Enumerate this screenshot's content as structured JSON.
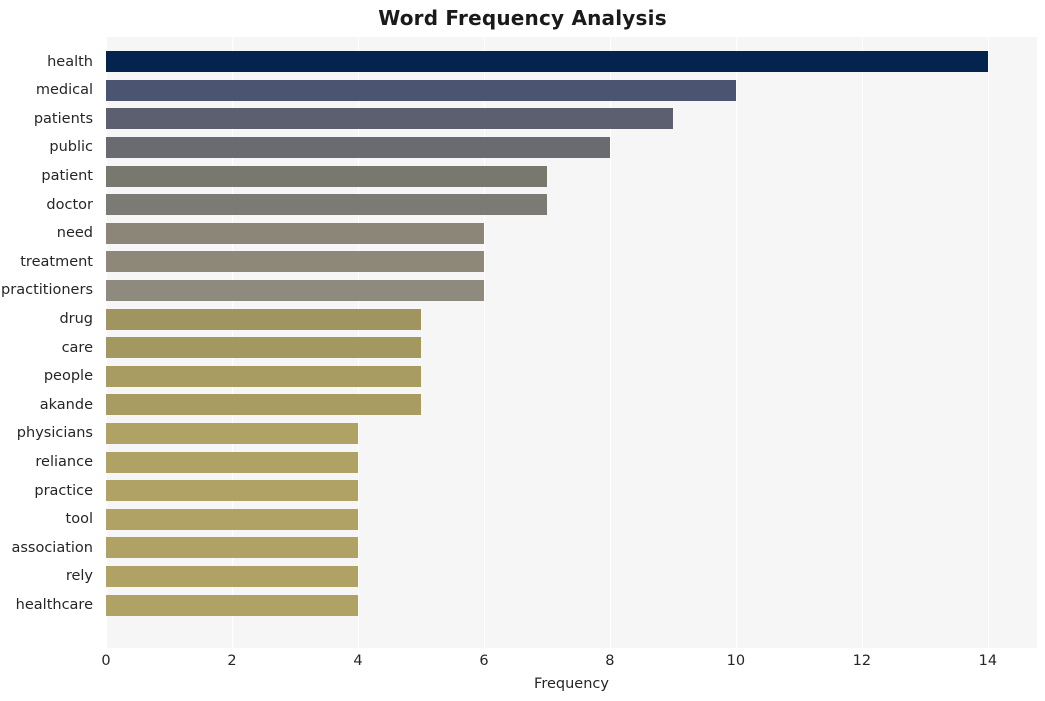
{
  "chart_data": {
    "type": "bar",
    "orientation": "horizontal",
    "title": "Word Frequency Analysis",
    "xlabel": "Frequency",
    "ylabel": "",
    "xlim": [
      0,
      14.78
    ],
    "xticks": [
      0,
      2,
      4,
      6,
      8,
      10,
      12,
      14
    ],
    "xtick_labels": [
      "0",
      "2",
      "4",
      "6",
      "8",
      "10",
      "12",
      "14"
    ],
    "grid": true,
    "grid_axis": "x",
    "legend": false,
    "plot_background": "#f6f6f7",
    "figure_background": "#ffffff",
    "categories": [
      "health",
      "medical",
      "patients",
      "public",
      "patient",
      "doctor",
      "need",
      "treatment",
      "practitioners",
      "drug",
      "care",
      "people",
      "akande",
      "physicians",
      "reliance",
      "practice",
      "tool",
      "association",
      "rely",
      "healthcare"
    ],
    "values": [
      14,
      10,
      9,
      8,
      7,
      7,
      6,
      6,
      6,
      5,
      5,
      5,
      5,
      4,
      4,
      4,
      4,
      4,
      4,
      4
    ],
    "bar_colors": [
      "#04234e",
      "#4b5470",
      "#5b5f70",
      "#6a6b70",
      "#78786f",
      "#7b7a74",
      "#8b8678",
      "#8e8878",
      "#8e8a7e",
      "#a09560",
      "#a49861",
      "#a89c63",
      "#a89c63",
      "#b0a165",
      "#b0a165",
      "#b0a165",
      "#b0a165",
      "#b0a165",
      "#b0a165",
      "#b0a165"
    ]
  }
}
